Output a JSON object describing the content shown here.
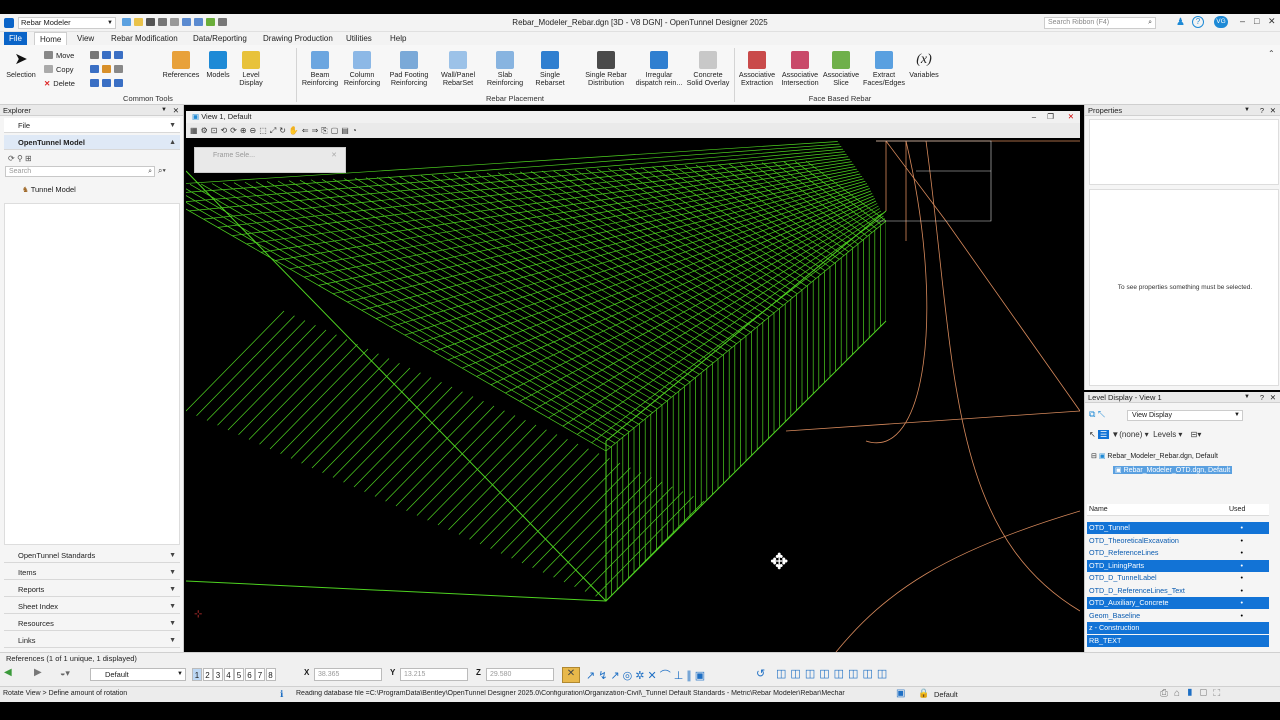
{
  "app": {
    "quick_title": "Rebar Modeler",
    "window_title": "Rebar_Modeler_Rebar.dgn [3D - V8 DGN] - OpenTunnel Designer 2025",
    "search_placeholder": "Search Ribbon (F4)",
    "user_initials": "VG"
  },
  "menu_tabs": [
    "File",
    "Home",
    "View",
    "Rebar Modification",
    "Data/Reporting",
    "Drawing Production",
    "Utilities",
    "Help"
  ],
  "ribbon": {
    "selection": "Selection",
    "move": "Move",
    "copy": "Copy",
    "delete": "Delete",
    "references": "References",
    "models": "Models",
    "level_display": "Level Display",
    "common_tools": "Common Tools",
    "beam": "Beam Reinforcing",
    "column": "Column Reinforcing",
    "pad": "Pad Footing Reinforcing",
    "wall": "Wall/Panel RebarSet",
    "slab": "Slab Reinforcing",
    "single_rebarset": "Single Rebarset",
    "single_rebar_dist": "Single Rebar Distribution",
    "irregular": "Irregular dispatch rein...",
    "concrete": "Concrete Solid Overlay",
    "rebar_placement": "Rebar Placement",
    "assoc_extraction": "Associative Extraction",
    "assoc_intersection": "Associative Intersection",
    "assoc_slice": "Associative Slice",
    "extract_faces": "Extract Faces/Edges",
    "variables": "Variables",
    "face_based": "Face Based Rebar"
  },
  "explorer": {
    "title": "Explorer",
    "file": "File",
    "model_section": "OpenTunnel Model",
    "search_placeholder": "Search",
    "tree_item": "Tunnel Model",
    "sections": [
      "OpenTunnel Standards",
      "Items",
      "Reports",
      "Sheet Index",
      "Resources",
      "Links"
    ]
  },
  "view": {
    "title": "View 1, Default",
    "dialog_title": "Frame Sele..."
  },
  "properties": {
    "title": "Properties",
    "empty_message": "To see properties something must be selected."
  },
  "level_display": {
    "title": "Level Display - View 1",
    "view_display": "View Display",
    "filter_none": "(none)",
    "levels": "Levels",
    "tree_root": "Rebar_Modeler_Rebar.dgn, Default",
    "tree_child": "Rebar_Modeler_OTD.dgn, Default",
    "col_name": "Name",
    "col_used": "Used",
    "rows": [
      {
        "name": "OTD_Tunnel",
        "selected": true,
        "used": "•"
      },
      {
        "name": "OTD_TheoreticalExcavation",
        "selected": false,
        "used": "•"
      },
      {
        "name": "OTD_ReferenceLines",
        "selected": false,
        "used": "•"
      },
      {
        "name": "OTD_LiningParts",
        "selected": true,
        "used": "•"
      },
      {
        "name": "OTD_D_TunnelLabel",
        "selected": false,
        "used": "•"
      },
      {
        "name": "OTD_D_ReferenceLines_Text",
        "selected": false,
        "used": "•"
      },
      {
        "name": "OTD_Auxiliary_Concrete",
        "selected": true,
        "used": "•"
      },
      {
        "name": "Geom_Baseline",
        "selected": false,
        "used": "•"
      },
      {
        "name": "z - Construction",
        "selected": true,
        "used": ""
      },
      {
        "name": "RB_TEXT",
        "selected": true,
        "used": ""
      }
    ]
  },
  "bottom": {
    "references": "References (1 of 1 unique, 1 displayed)",
    "view_numbers": [
      "1",
      "2",
      "3",
      "4",
      "5",
      "6",
      "7",
      "8"
    ],
    "default": "Default",
    "x_label": "X",
    "x_value": "38.365",
    "y_label": "Y",
    "y_value": "13.215",
    "z_label": "Z",
    "z_value": "29.580",
    "prompt": "Rotate View > Define amount of rotation",
    "status_message": "Reading database file =C:\\ProgramData\\Bentley\\OpenTunnel Designer 2025.0\\Configuration\\Organization-Civil\\_Tunnel Default Standards - Metric\\Rebar Modeler\\Rebar\\Mechar",
    "active_level": "Default"
  },
  "colors": {
    "accent": "#0a64c8",
    "rebar": "#4ed321",
    "tunnel_line": "#d88a5c",
    "level_selected": "#1273d6"
  }
}
